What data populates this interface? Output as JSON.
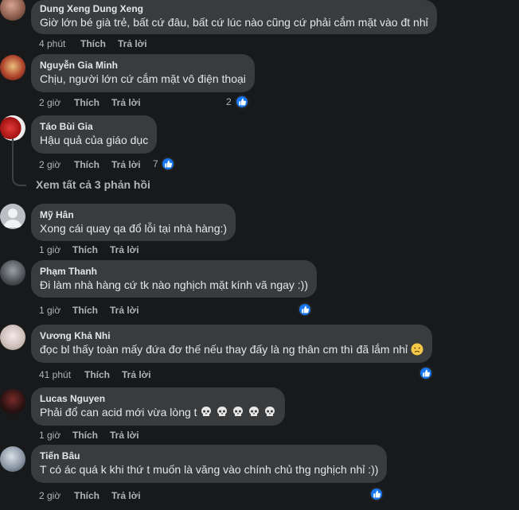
{
  "comments": [
    {
      "author": "Dung Xeng Dung Xeng",
      "text": "Giờ lớn bé già trẻ, bất cứ đâu, bất cứ lúc nào cũng cứ phải cắm mặt vào đt nhỉ",
      "time": "4 phút",
      "like": "Thích",
      "reply": "Trả lời",
      "reactions": ""
    },
    {
      "author": "Nguyễn Gia Minh",
      "text": "Chịu, người lớn cứ cắm mặt vô điện thoại",
      "time": "2 giờ",
      "like": "Thích",
      "reply": "Trả lời",
      "reactions": "2"
    },
    {
      "author": "Táo Bùi Gia",
      "text": "Hậu quả của giáo dục",
      "time": "2 giờ",
      "like": "Thích",
      "reply": "Trả lời",
      "reactions": "7"
    },
    {
      "author": "Mỹ Hân",
      "text": "Xong cái quay qa đổ lỗi tại nhà hàng:)",
      "time": "1 giờ",
      "like": "Thích",
      "reply": "Trả lời",
      "reactions": ""
    },
    {
      "author": "Phạm Thanh",
      "text": "Đi làm nhà hàng cứ tk nào nghịch mặt kính vã ngay :))",
      "time": "1 giờ",
      "like": "Thích",
      "reply": "Trả lời",
      "reactions": ""
    },
    {
      "author": "Vương Khả Nhi",
      "text": "đọc bl thấy toàn mấy đứa đơ thế nếu thay đấy là ng thân cm thì đã lắm nhỉ",
      "time": "41 phút",
      "like": "Thích",
      "reply": "Trả lời",
      "reactions": ""
    },
    {
      "author": "Lucas Nguyen",
      "text": "Phải đổ can acid mới vừa lòng t",
      "time": "1 giờ",
      "like": "Thích",
      "reply": "Trả lời",
      "reactions": ""
    },
    {
      "author": "Tiến Bâu",
      "text": "T có ác quá k khi thứ t muốn là văng vào chính chủ thg nghịch nhỉ :))",
      "time": "2 giờ",
      "like": "Thích",
      "reply": "Trả lời",
      "reactions": ""
    }
  ],
  "view_replies": "Xem tất cả 3 phản hồi",
  "colors": {
    "background": "#18191a",
    "bubble": "#3a3b3c",
    "like_blue": "#1877f2",
    "muted": "#b0b3b8"
  },
  "icons": [
    "like-icon",
    "skull-icon",
    "sad-face-icon",
    "reply-thread-icon"
  ]
}
